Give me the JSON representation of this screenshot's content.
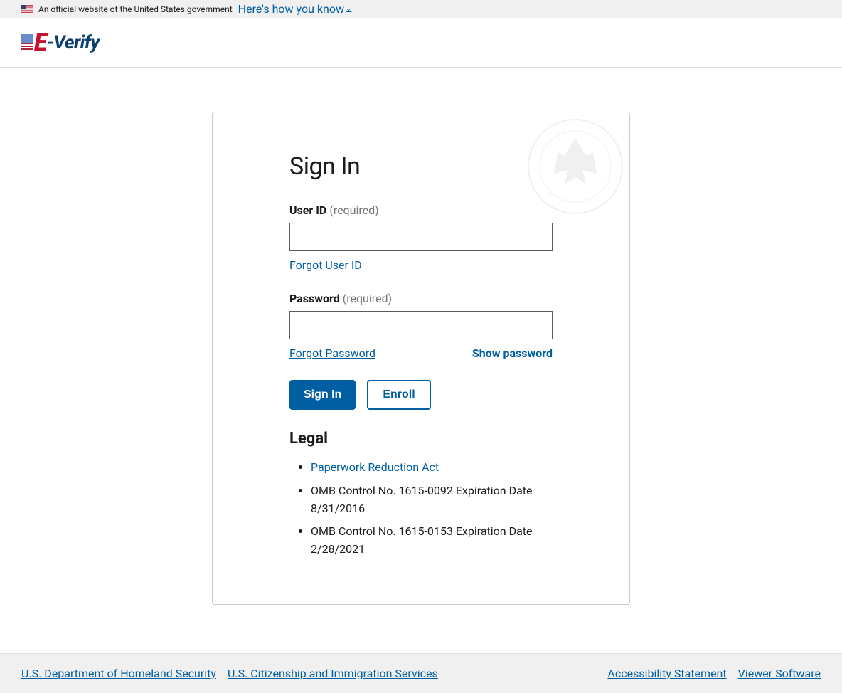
{
  "banner": {
    "text": "An official website of the United States government",
    "link": "Here's how you know"
  },
  "logo": {
    "e": "E",
    "dash": "-",
    "rest": "Verify"
  },
  "signin": {
    "title": "Sign In",
    "userid": {
      "label": "User ID",
      "required": "(required)",
      "forgot": "Forgot User ID"
    },
    "password": {
      "label": "Password",
      "required": "(required)",
      "forgot": "Forgot Password",
      "show": "Show password"
    },
    "buttons": {
      "signin": "Sign In",
      "enroll": "Enroll"
    }
  },
  "legal": {
    "heading": "Legal",
    "items": [
      {
        "link": "Paperwork Reduction Act",
        "plain": null
      },
      {
        "link": null,
        "plain": "OMB Control No. 1615-0092 Expiration Date 8/31/2016"
      },
      {
        "link": null,
        "plain": "OMB Control No. 1615-0153 Expiration Date 2/28/2021"
      }
    ]
  },
  "footer": {
    "left": [
      "U.S. Department of Homeland Security",
      "U.S. Citizenship and Immigration Services"
    ],
    "right": [
      "Accessibility Statement",
      "Viewer Software"
    ]
  }
}
